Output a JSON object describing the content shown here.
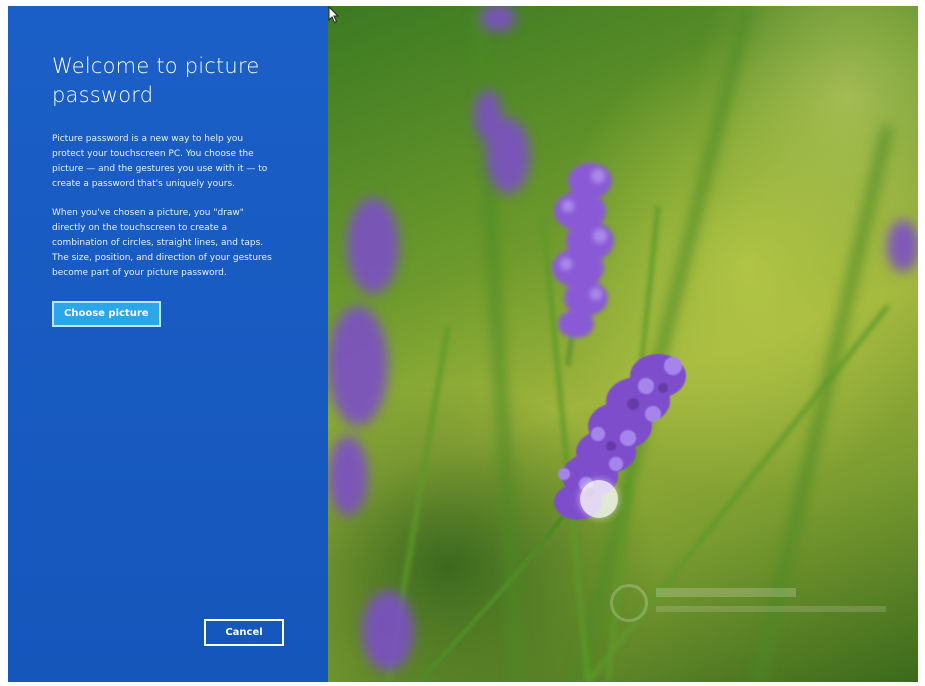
{
  "panel": {
    "title": "Welcome to picture password",
    "paragraphs": [
      "Picture password is a new way to help you protect your touchscreen PC. You choose the picture — and the gestures you use with it — to create a password that's uniquely yours.",
      "When you've chosen a picture, you \"draw\" directly on the touchscreen to create a combination of circles, straight lines, and taps. The size, position, and direction of your gestures become part of your picture password."
    ],
    "choose_button_label": "Choose picture",
    "cancel_button_label": "Cancel",
    "accent_color": "#1a5fc7",
    "button_color": "#2aa6ea"
  },
  "photo": {
    "subject": "lavender-flowers",
    "background_color": "#6d9a2c",
    "flower_color": "#8a5ad6"
  },
  "icons": {
    "cursor": "mouse-pointer-icon",
    "touch": "touch-point-indicator",
    "watermark": "watermark-logo-icon"
  }
}
